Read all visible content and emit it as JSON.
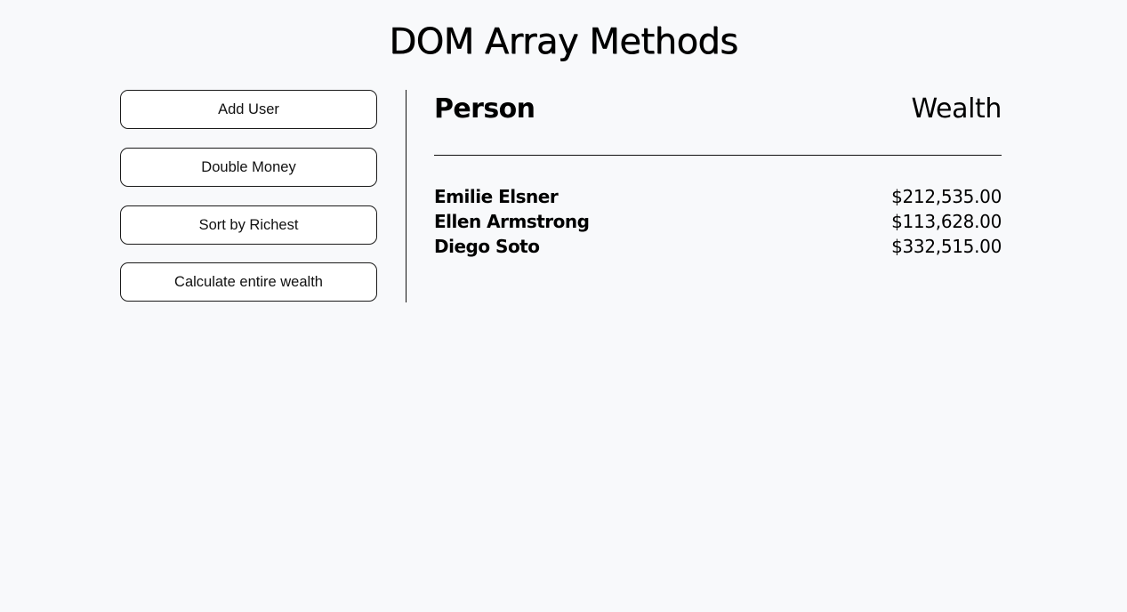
{
  "page": {
    "title": "DOM Array Methods"
  },
  "sidebar": {
    "buttons": [
      {
        "label": "Add User"
      },
      {
        "label": "Double Money"
      },
      {
        "label": "Sort by Richest"
      },
      {
        "label": "Calculate entire wealth"
      }
    ]
  },
  "table": {
    "header": {
      "person": "Person",
      "wealth": "Wealth"
    },
    "rows": [
      {
        "name": "Emilie Elsner",
        "wealth": "$212,535.00"
      },
      {
        "name": "Ellen Armstrong",
        "wealth": "$113,628.00"
      },
      {
        "name": "Diego Soto",
        "wealth": "$332,515.00"
      }
    ]
  }
}
